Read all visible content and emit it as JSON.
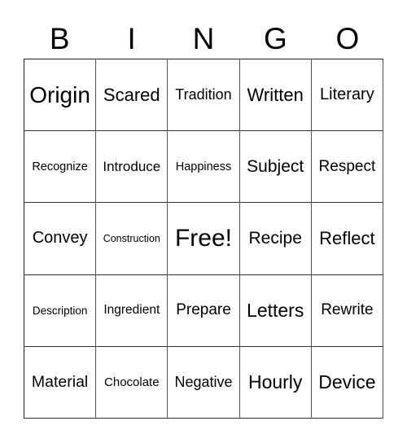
{
  "header": {
    "letters": [
      "B",
      "I",
      "N",
      "G",
      "O"
    ]
  },
  "board": {
    "rows": [
      [
        {
          "text": "Origin",
          "size": 28
        },
        {
          "text": "Scared",
          "size": 22
        },
        {
          "text": "Tradition",
          "size": 18
        },
        {
          "text": "Written",
          "size": 22
        },
        {
          "text": "Literary",
          "size": 20
        }
      ],
      [
        {
          "text": "Recognize",
          "size": 14.5
        },
        {
          "text": "Introduce",
          "size": 17
        },
        {
          "text": "Happiness",
          "size": 14.5
        },
        {
          "text": "Subject",
          "size": 21
        },
        {
          "text": "Respect",
          "size": 19
        }
      ],
      [
        {
          "text": "Convey",
          "size": 20
        },
        {
          "text": "Construction",
          "size": 12.5
        },
        {
          "text": "Free!",
          "size": 30
        },
        {
          "text": "Recipe",
          "size": 21
        },
        {
          "text": "Reflect",
          "size": 22
        }
      ],
      [
        {
          "text": "Description",
          "size": 13.5
        },
        {
          "text": "Ingredient",
          "size": 15.5
        },
        {
          "text": "Prepare",
          "size": 19
        },
        {
          "text": "Letters",
          "size": 23
        },
        {
          "text": "Rewrite",
          "size": 19
        }
      ],
      [
        {
          "text": "Material",
          "size": 19.5
        },
        {
          "text": "Chocolate",
          "size": 15
        },
        {
          "text": "Negative",
          "size": 18
        },
        {
          "text": "Hourly",
          "size": 23
        },
        {
          "text": "Device",
          "size": 23
        }
      ]
    ]
  }
}
